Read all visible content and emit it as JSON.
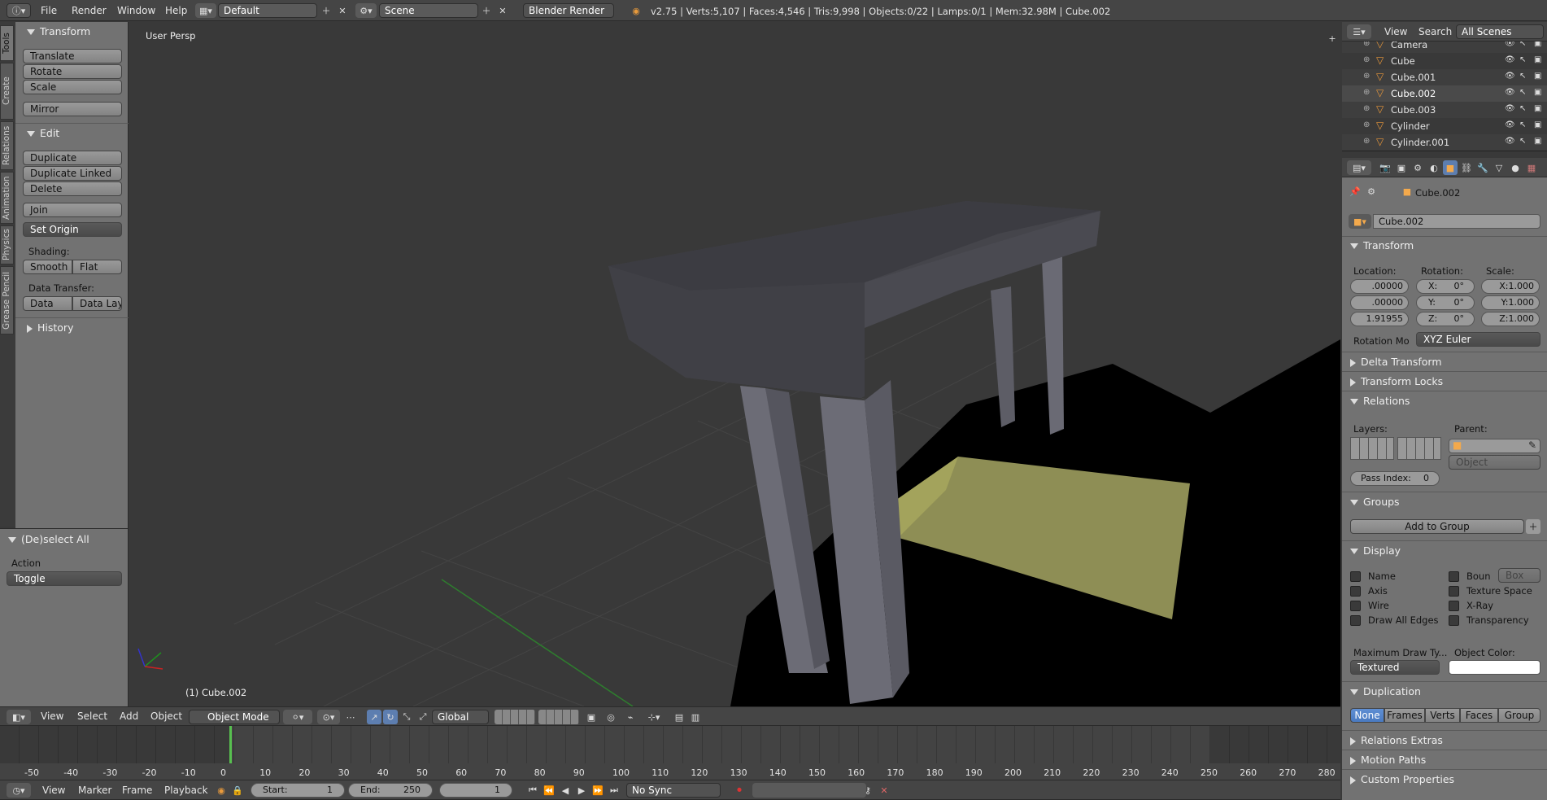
{
  "topbar": {
    "menu": [
      "File",
      "Render",
      "Window",
      "Help"
    ],
    "screen_layout": "Default",
    "scene": "Scene",
    "render_engine": "Blender Render",
    "stats": "v2.75 | Verts:5,107 | Faces:4,546 | Tris:9,998 | Objects:0/22 | Lamps:0/1 | Mem:32.98M | Cube.002"
  },
  "tool_tabs": [
    "Tools",
    "Create",
    "Relations",
    "Animation",
    "Physics",
    "Grease Pencil"
  ],
  "toolshelf": {
    "transform_title": "Transform",
    "transform_buttons": [
      "Translate",
      "Rotate",
      "Scale"
    ],
    "mirror": "Mirror",
    "edit_title": "Edit",
    "edit_buttons": [
      "Duplicate",
      "Duplicate Linked",
      "Delete"
    ],
    "join": "Join",
    "set_origin": "Set Origin",
    "shading_label": "Shading:",
    "smooth": "Smooth",
    "flat": "Flat",
    "data_transfer_label": "Data Transfer:",
    "data": "Data",
    "data_layo": "Data Layo",
    "history_title": "History",
    "operator_title": "(De)select All",
    "action_label": "Action",
    "action_value": "Toggle"
  },
  "viewport": {
    "view_label": "User Persp",
    "object_label": "(1) Cube.002",
    "colors": {
      "bg": "#393939",
      "floor_plane": "#8f8f56",
      "table_top": "#45454b",
      "leg": "#6c6c76",
      "shadow": "#000000"
    }
  },
  "viewport_header": {
    "menu": [
      "View",
      "Select",
      "Add",
      "Object"
    ],
    "mode": "Object Mode",
    "orientation": "Global"
  },
  "timeline": {
    "ticks": [
      "-50",
      "-40",
      "-30",
      "-20",
      "-10",
      "0",
      "10",
      "20",
      "30",
      "40",
      "50",
      "60",
      "70",
      "80",
      "90",
      "100",
      "110",
      "120",
      "130",
      "140",
      "150",
      "160",
      "170",
      "180",
      "190",
      "200",
      "210",
      "220",
      "230",
      "240",
      "250",
      "260",
      "270",
      "280"
    ],
    "menu": [
      "View",
      "Marker",
      "Frame",
      "Playback"
    ],
    "start_label": "Start:",
    "start": "1",
    "end_label": "End:",
    "end": "250",
    "current": "1",
    "sync": "No Sync"
  },
  "outliner": {
    "header": [
      "View",
      "Search",
      "All Scenes"
    ],
    "items": [
      "Camera",
      "Cube",
      "Cube.001",
      "Cube.002",
      "Cube.003",
      "Cylinder",
      "Cylinder.001"
    ],
    "selected": "Cube.002"
  },
  "properties": {
    "breadcrumb": "Cube.002",
    "object_name": "Cube.002",
    "transform_title": "Transform",
    "location_label": "Location:",
    "rotation_label": "Rotation:",
    "scale_label": "Scale:",
    "location": [
      ".00000",
      ".00000",
      "1.91955"
    ],
    "rotation": [
      "X:",
      "Y:",
      "Z:"
    ],
    "rotation_values": [
      "0°",
      "0°",
      "0°"
    ],
    "scale": [
      "X:1.000",
      "Y:1.000",
      "Z:1.000"
    ],
    "rotation_mode_label": "Rotation Mo",
    "rotation_mode": "XYZ Euler",
    "delta_transform": "Delta Transform",
    "transform_locks": "Transform Locks",
    "relations_title": "Relations",
    "layers_label": "Layers:",
    "parent_label": "Parent:",
    "parent_type": "Object",
    "pass_index_label": "Pass Index:",
    "pass_index": "0",
    "groups_title": "Groups",
    "add_to_group": "Add to Group",
    "display_title": "Display",
    "display_left": [
      "Name",
      "Axis",
      "Wire",
      "Draw All Edges"
    ],
    "display_right": [
      "Boun",
      "Texture Space",
      "X-Ray",
      "Transparency"
    ],
    "bounds_type": "Box",
    "max_draw_label": "Maximum Draw Ty...",
    "object_color_label": "Object Color:",
    "max_draw": "Textured",
    "duplication_title": "Duplication",
    "duplication_options": [
      "None",
      "Frames",
      "Verts",
      "Faces",
      "Group"
    ],
    "relations_extras": "Relations Extras",
    "motion_paths": "Motion Paths",
    "custom_properties": "Custom Properties"
  }
}
